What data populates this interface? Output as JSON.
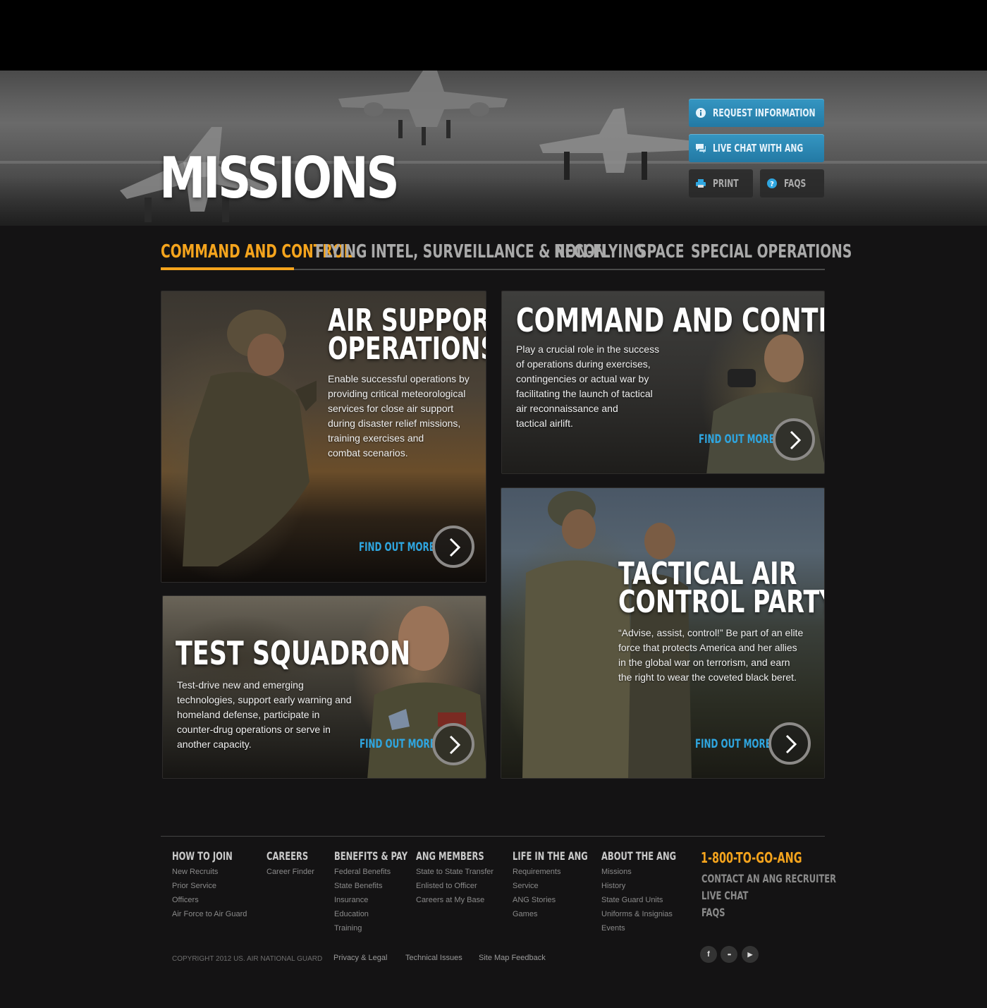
{
  "hero": {
    "title": "MISSIONS",
    "buttons": {
      "request_info": "REQUEST INFORMATION",
      "live_chat": "LIVE CHAT WITH ANG",
      "print": "PRINT",
      "faqs": "FAQS"
    }
  },
  "tabs": [
    {
      "label": "COMMAND AND CONTROL",
      "active": true
    },
    {
      "label": "FLYING"
    },
    {
      "label": "INTEL, SURVEILLANCE & RECON"
    },
    {
      "label": "NON-FLYING"
    },
    {
      "label": "SPACE"
    },
    {
      "label": "SPECIAL OPERATIONS"
    }
  ],
  "cards": [
    {
      "title_line1": "AIR SUPPORT",
      "title_line2": "OPERATIONS",
      "lines": [
        "Enable successful operations by",
        "providing critical meteorological",
        "services for close air support",
        "during disaster relief missions,",
        "training exercises and",
        "combat scenarios."
      ],
      "cta": "FIND OUT MORE"
    },
    {
      "title_line1": "COMMAND AND CONTROL",
      "lines": [
        "Play a crucial role in the success",
        "of operations during exercises,",
        "contingencies or actual war by",
        "facilitating the launch of tactical",
        "air reconnaissance and",
        "tactical airlift."
      ],
      "cta": "FIND OUT MORE"
    },
    {
      "title_line1": "TEST SQUADRON",
      "lines": [
        "Test-drive new and emerging",
        "technologies, support early warning and",
        "homeland defense, participate in",
        "counter-drug operations or serve in",
        "another capacity."
      ],
      "cta": "FIND OUT MORE"
    },
    {
      "title_line1": "TACTICAL AIR",
      "title_line2": "CONTROL PARTY",
      "lines": [
        "“Advise, assist, control!” Be part of an elite",
        "force that protects America and her allies",
        "in the global war on terrorism, and earn",
        "the right to wear the coveted black beret."
      ],
      "cta": "FIND OUT MORE"
    }
  ],
  "footer": {
    "columns": [
      {
        "heading": "HOW TO JOIN",
        "links": [
          "New Recruits",
          "Prior Service",
          "Officers",
          "Air Force to Air Guard"
        ]
      },
      {
        "heading": "CAREERS",
        "links": [
          "Career Finder"
        ]
      },
      {
        "heading": "BENEFITS & PAY",
        "links": [
          "Federal Benefits",
          "State Benefits",
          "Insurance",
          "Education",
          "Training"
        ]
      },
      {
        "heading": "ANG MEMBERS",
        "links": [
          "State to State Transfer",
          "Enlisted to Officer",
          "Careers at My Base"
        ]
      },
      {
        "heading": "LIFE IN THE ANG",
        "links": [
          "Requirements",
          "Service",
          "ANG Stories",
          "Games"
        ]
      },
      {
        "heading": "ABOUT THE ANG",
        "links": [
          "Missions",
          "History",
          "State Guard Units",
          "Uniforms & Insignias",
          "Events"
        ]
      }
    ],
    "phone": "1-800-TO-GO-ANG",
    "contact_links": [
      "CONTACT AN ANG RECRUITER",
      "LIVE CHAT",
      "FAQS"
    ],
    "copyright": "COPYRIGHT 2012 US. AIR NATIONAL GUARD",
    "legal_links": [
      "Privacy & Legal",
      "Technical Issues",
      "Site Map Feedback"
    ],
    "social": [
      {
        "icon": "facebook-icon",
        "glyph": "f"
      },
      {
        "icon": "flickr-icon",
        "glyph": "••"
      },
      {
        "icon": "youtube-icon",
        "glyph": "▶"
      }
    ]
  },
  "colors": {
    "accent_orange": "#f5a41d",
    "link_blue": "#2fa6e0",
    "button_blue": "#2a86b3",
    "background": "#141314"
  }
}
